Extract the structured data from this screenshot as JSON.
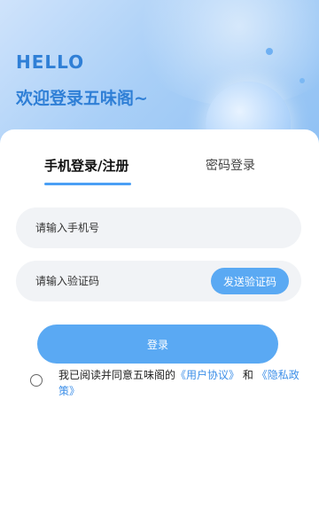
{
  "header": {
    "hello": "HELLO",
    "welcome": "欢迎登录五味阁~"
  },
  "tabs": [
    {
      "label": "手机登录/注册",
      "active": true
    },
    {
      "label": "密码登录",
      "active": false
    }
  ],
  "form": {
    "phone_placeholder": "请输入手机号",
    "code_placeholder": "请输入验证码",
    "send_code_label": "发送验证码",
    "login_label": "登录"
  },
  "agreement": {
    "checked": false,
    "prefix": "我已阅读并同意五味阁的",
    "user_agreement": "《用户协议》",
    "conjunction": "和",
    "privacy_policy": "《隐私政策》"
  },
  "colors": {
    "accent": "#5aa9f3",
    "heading": "#2f7fd6",
    "link": "#3d8fe8"
  }
}
